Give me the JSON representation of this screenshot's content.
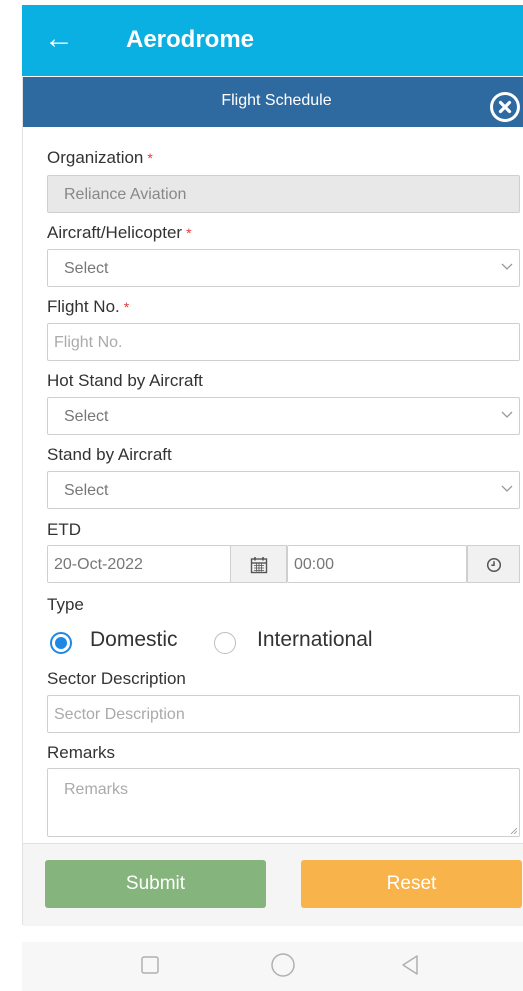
{
  "app": {
    "title": "Aerodrome"
  },
  "modal": {
    "title": "Flight Schedule"
  },
  "form": {
    "organization": {
      "label": "Organization",
      "required": "*",
      "value": "Reliance Aviation"
    },
    "aircraft": {
      "label": "Aircraft/Helicopter",
      "required": "*",
      "value": "Select"
    },
    "flight_no": {
      "label": "Flight No.",
      "required": "*",
      "placeholder": "Flight No."
    },
    "hot_standby": {
      "label": "Hot Stand by Aircraft",
      "value": "Select"
    },
    "standby": {
      "label": "Stand by Aircraft",
      "value": "Select"
    },
    "etd": {
      "label": "ETD",
      "date": "20-Oct-2022",
      "time": "00:00"
    },
    "type": {
      "label": "Type",
      "options": [
        "Domestic",
        "International"
      ],
      "selected": "Domestic"
    },
    "sector": {
      "label": "Sector Description",
      "placeholder": "Sector Description"
    },
    "remarks": {
      "label": "Remarks",
      "placeholder": "Remarks"
    }
  },
  "buttons": {
    "submit": "Submit",
    "reset": "Reset"
  },
  "icons": {
    "back": "arrow-left-icon",
    "close": "close-circle-icon",
    "chevron": "chevron-down-icon",
    "calendar": "calendar-icon",
    "clock": "clock-icon",
    "nav": [
      "square-recents-icon",
      "circle-home-icon",
      "triangle-back-icon"
    ]
  },
  "colors": {
    "appbar": "#0bb0e3",
    "modal_header": "#2e6aa0",
    "submit": "#85b47c",
    "reset": "#f9b34b",
    "radio": "#1e88e5",
    "required": "#e53935"
  }
}
